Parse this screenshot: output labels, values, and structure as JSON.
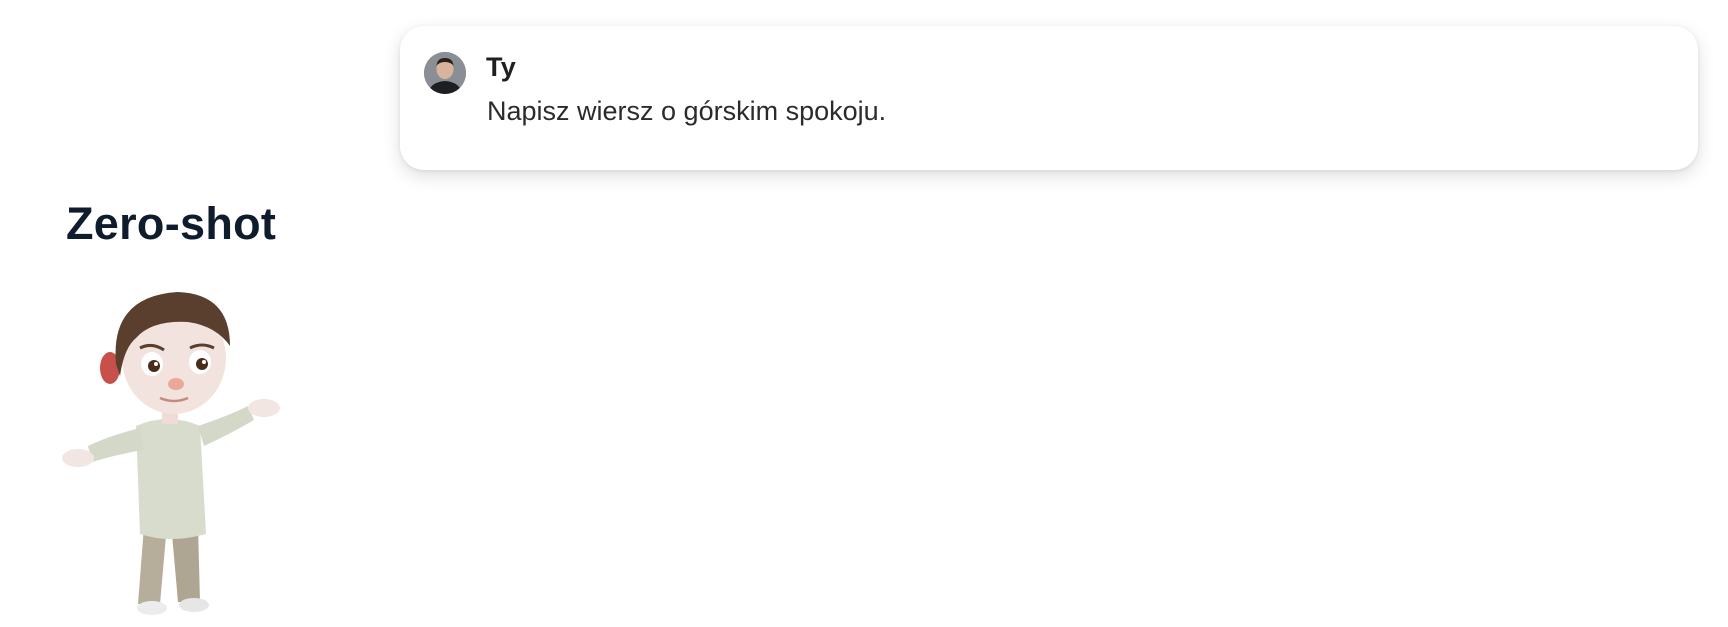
{
  "message": {
    "author": "Ty",
    "text": "Napisz wiersz o górskim spokoju."
  },
  "section": {
    "title": "Zero-shot"
  },
  "icons": {
    "avatar": "user-avatar-photo",
    "character": "shrugging-cartoon-character"
  },
  "colors": {
    "title": "#0f1c2e",
    "card_background": "#ffffff",
    "text": "#2b2b2b"
  }
}
